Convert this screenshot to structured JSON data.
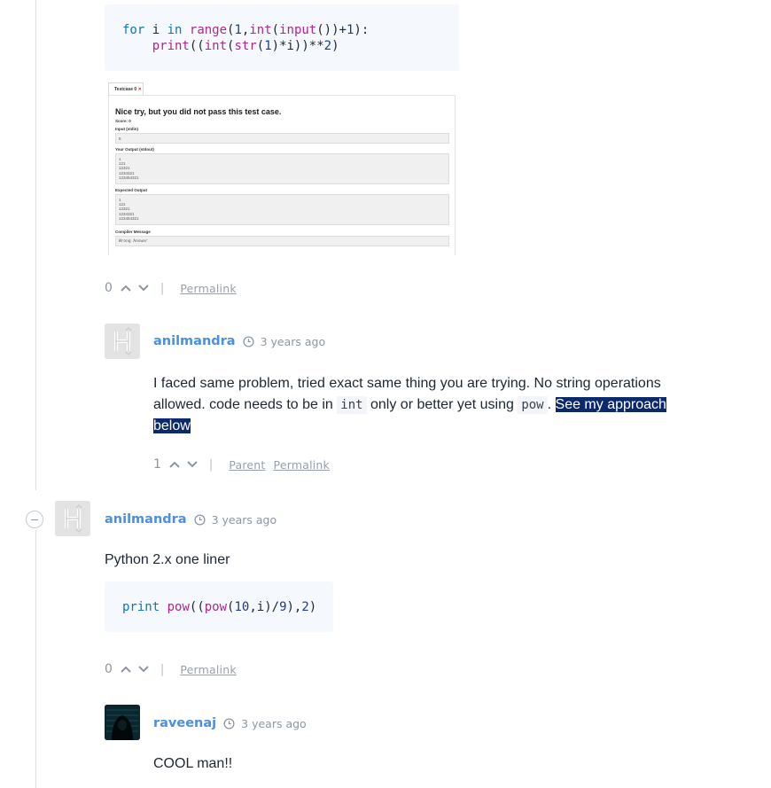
{
  "code1": {
    "line1": {
      "kw1": "for",
      "var": " i ",
      "kw2": "in",
      "sp": " ",
      "fn1": "range",
      "p1": "(",
      "n1": "1",
      "p2": ",",
      "fn2": "int",
      "p3": "(",
      "fn3": "input",
      "p4": "())+",
      "n2": "1",
      "p5": "):"
    },
    "line2": {
      "indent": "    ",
      "fn1": "print",
      "p1": "((",
      "fn2": "int",
      "p2": "(",
      "fn3": "str",
      "p3": "(",
      "n1": "1",
      "p4": ")*i))**",
      "n2": "2",
      "p5": ")"
    }
  },
  "testcase_shot": {
    "tab_label": "Testcase 0",
    "tab_mark": "✕",
    "heading": "Nice try, but you did not pass this test case.",
    "score": "Score: 0",
    "input_label": "Input (stdin)",
    "input_value": "5",
    "your_output_label": "Your Output (stdout)",
    "your_output_value": "1\n121\n12321\n1234321\n123454321",
    "expected_label": "Expected Output",
    "expected_value": "1\n121\n12321\n1234321\n123454321",
    "compiler_label": "Compiler Message",
    "compiler_value": "Wrong Answer"
  },
  "post1_actions": {
    "count": "0",
    "permalink": "Permalink"
  },
  "reply1": {
    "author": "anilmandra",
    "time": "3 years ago",
    "text_a": "I faced same problem, tried exact same thing you are trying. No string operations allowed. code needs to be in ",
    "code_a": "int",
    "text_b": " only or better yet using ",
    "code_b": "pow",
    "text_c": ". ",
    "highlight": "See my approach below",
    "count": "1",
    "parent": "Parent",
    "permalink": "Permalink"
  },
  "post2": {
    "author": "anilmandra",
    "time": "3 years ago",
    "text": "Python 2.x one liner",
    "code": {
      "kw": "print",
      "sp": " ",
      "fn1": "pow",
      "p1": "((",
      "fn2": "pow",
      "p2": "(",
      "n1": "10",
      "p3": ",i)/",
      "n2": "9",
      "p4": "),",
      "n3": "2",
      "p5": ")"
    },
    "count": "0",
    "permalink": "Permalink"
  },
  "reply2": {
    "author": "raveenaj",
    "time": "3 years ago",
    "text": "COOL man!!"
  },
  "colors": {
    "link": "#4a90e2",
    "highlight": "#0b2a6b",
    "code_bg": "#f5f8fc"
  }
}
